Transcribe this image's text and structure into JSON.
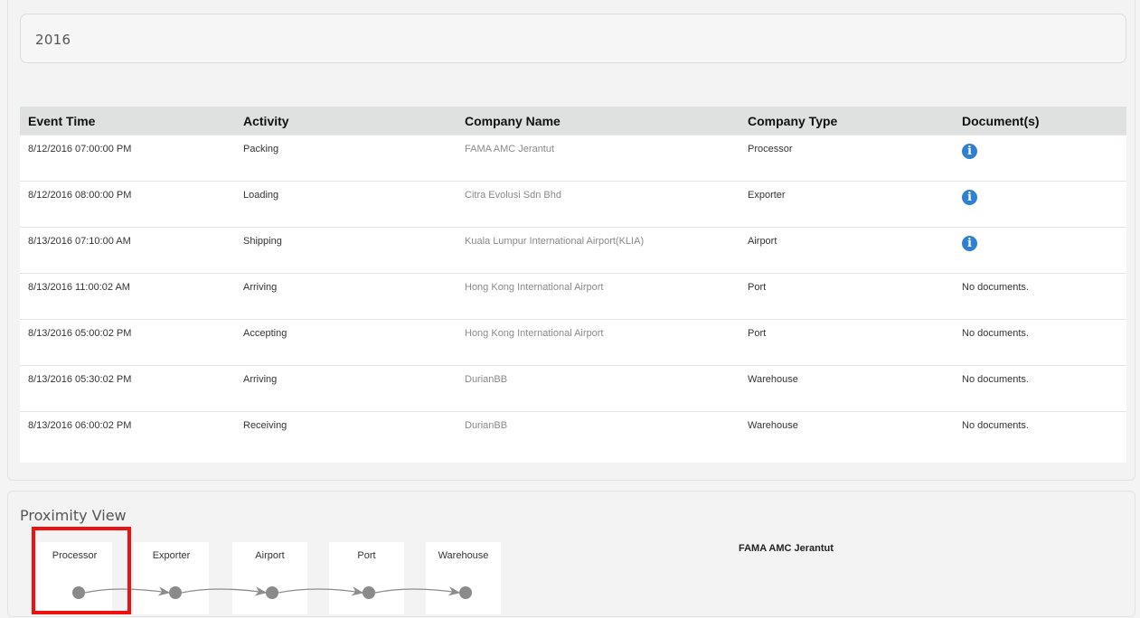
{
  "year": "2016",
  "table": {
    "headers": {
      "event_time": "Event Time",
      "activity": "Activity",
      "company_name": "Company Name",
      "company_type": "Company Type",
      "documents": "Document(s)"
    },
    "rows": [
      {
        "event_time": "8/12/2016 07:00:00 PM",
        "activity": "Packing",
        "company_name": "FAMA AMC Jerantut",
        "company_type": "Processor",
        "document": "info-icon"
      },
      {
        "event_time": "8/12/2016 08:00:00 PM",
        "activity": "Loading",
        "company_name": "Citra Evolusi Sdn Bhd",
        "company_type": "Exporter",
        "document": "info-icon"
      },
      {
        "event_time": "8/13/2016 07:10:00 AM",
        "activity": "Shipping",
        "company_name": "Kuala Lumpur International Airport(KLIA)",
        "company_type": "Airport",
        "document": "info-icon"
      },
      {
        "event_time": "8/13/2016 11:00:02 AM",
        "activity": "Arriving",
        "company_name": "Hong Kong International Airport",
        "company_type": "Port",
        "document": "No documents."
      },
      {
        "event_time": "8/13/2016 05:00:02 PM",
        "activity": "Accepting",
        "company_name": "Hong Kong International Airport",
        "company_type": "Port",
        "document": "No documents."
      },
      {
        "event_time": "8/13/2016 05:30:02 PM",
        "activity": "Arriving",
        "company_name": "DurianBB",
        "company_type": "Warehouse",
        "document": "No documents."
      },
      {
        "event_time": "8/13/2016 06:00:02 PM",
        "activity": "Receiving",
        "company_name": "DurianBB",
        "company_type": "Warehouse",
        "document": "No documents."
      }
    ],
    "info_glyph": "i",
    "info_color": "#2f80d1"
  },
  "proximity": {
    "title": "Proximity View",
    "nodes": [
      {
        "label": "Processor"
      },
      {
        "label": "Exporter"
      },
      {
        "label": "Airport"
      },
      {
        "label": "Port"
      },
      {
        "label": "Warehouse"
      }
    ],
    "selected_index": 0,
    "selected_company": "FAMA AMC Jerantut",
    "highlight_color": "#ee1111"
  }
}
